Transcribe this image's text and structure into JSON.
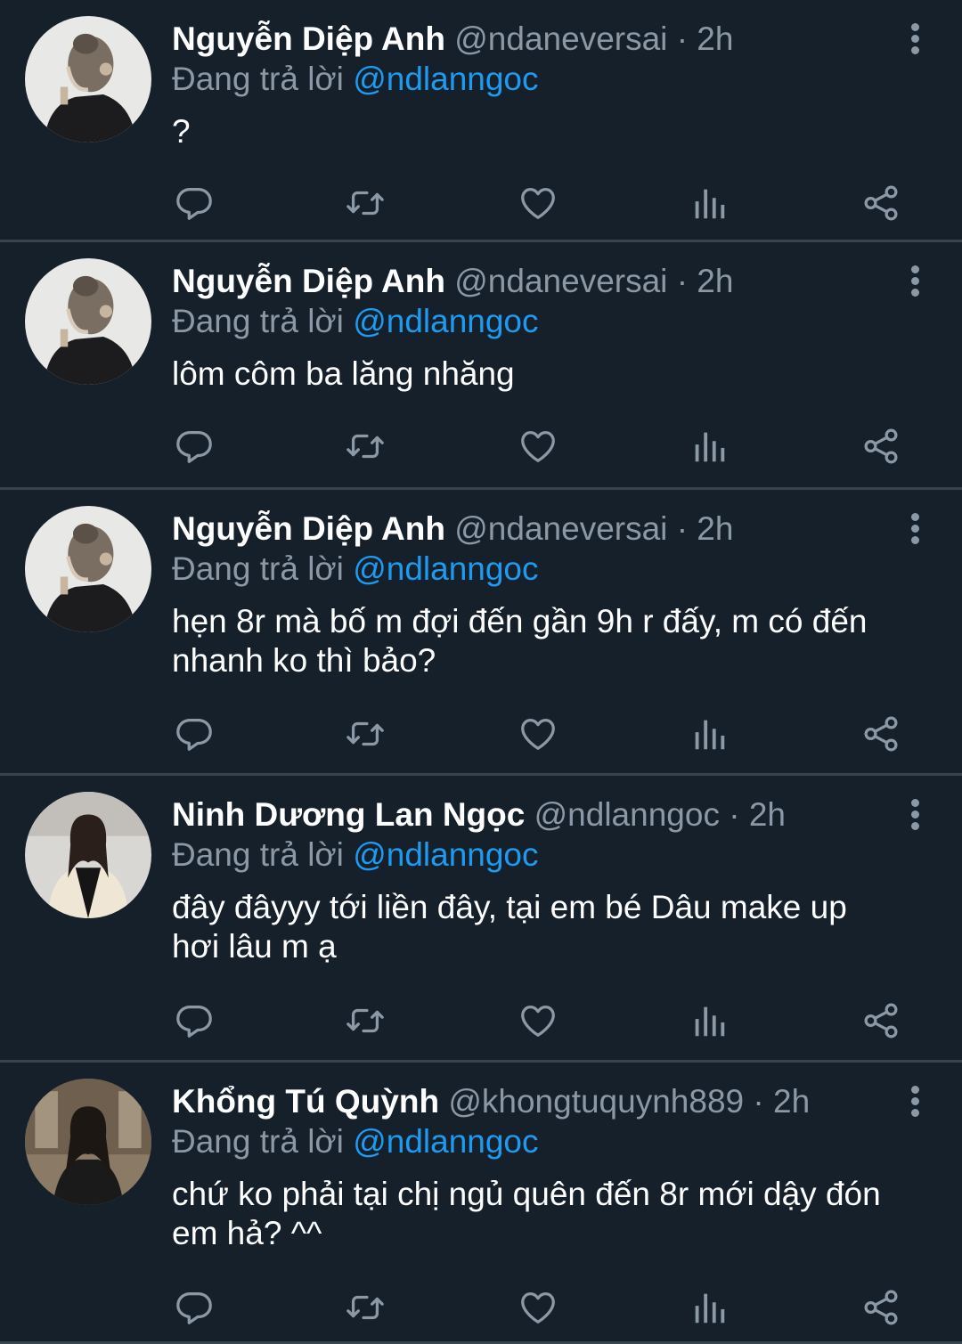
{
  "colors": {
    "background": "#15202b",
    "text": "#ffffff",
    "muted": "#8b98a5",
    "accent": "#1d9bf0",
    "divider": "#38444d"
  },
  "replying_label": "Đang trả lời",
  "tweets": [
    {
      "name": "Nguyễn Diệp Anh",
      "handle": "@ndaneversai",
      "time": "· 2h",
      "mention": "@ndlanngoc",
      "text": "?",
      "avatar": "avatar-1"
    },
    {
      "name": "Nguyễn Diệp Anh",
      "handle": "@ndaneversai",
      "time": "· 2h",
      "mention": "@ndlanngoc",
      "text": "lôm côm ba lăng nhăng",
      "avatar": "avatar-1"
    },
    {
      "name": "Nguyễn Diệp Anh",
      "handle": "@ndaneversai",
      "time": "· 2h",
      "mention": "@ndlanngoc",
      "text": "hẹn 8r mà bố m đợi đến gần 9h r đấy, m có đến nhanh ko thì bảo?",
      "avatar": "avatar-1"
    },
    {
      "name": "Ninh Dương Lan Ngọc",
      "handle": "@ndlanngoc",
      "time": "· 2h",
      "mention": "@ndlanngoc",
      "text": "đây đâyyy tới liền đây, tại em bé Dâu make up hơi lâu m ạ",
      "avatar": "avatar-2"
    },
    {
      "name": "Khổng Tú Quỳnh",
      "handle": "@khongtuquynh889",
      "time": "· 2h",
      "mention": "@ndlanngoc",
      "text": "chứ ko phải tại chị ngủ quên đến 8r mới dậy đón em hả? ^^",
      "avatar": "avatar-3"
    }
  ],
  "action_icons": [
    "reply-icon",
    "retweet-icon",
    "like-icon",
    "analytics-icon",
    "share-icon"
  ]
}
